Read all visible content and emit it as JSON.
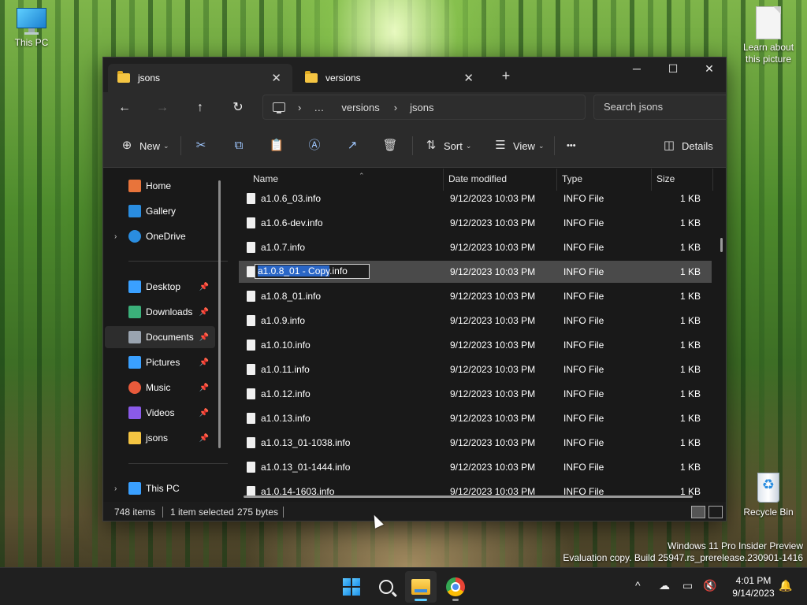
{
  "desktop": {
    "icons": [
      {
        "label": "This PC"
      },
      {
        "label": "Learn about this picture"
      },
      {
        "label": "Recycle Bin"
      }
    ],
    "watermark_line1": "Windows 11 Pro Insider Preview",
    "watermark_line2": "Evaluation copy. Build 25947.rs_prerelease.230901-1416"
  },
  "window": {
    "tabs": [
      {
        "label": "jsons",
        "active": true
      },
      {
        "label": "versions",
        "active": false
      }
    ],
    "new_tab": "+",
    "caption": {
      "minimize": "─",
      "maximize": "☐",
      "close": "✕"
    },
    "nav": {
      "back": "←",
      "forward": "→",
      "up": "↑",
      "refresh": "↻"
    },
    "breadcrumb": [
      "…",
      "versions",
      "jsons"
    ],
    "search_placeholder": "Search jsons",
    "toolbar": {
      "new_label": "New",
      "sort_label": "Sort",
      "view_label": "View",
      "more_label": "•••",
      "details_label": "Details"
    },
    "sidebar": {
      "items": [
        {
          "label": "Home",
          "color": "#e8743b",
          "expand": false,
          "pin": false
        },
        {
          "label": "Gallery",
          "color": "#2a8de0",
          "expand": false,
          "pin": false
        },
        {
          "label": "OneDrive",
          "color": "#2a8de0",
          "expand": true,
          "pin": false
        },
        {
          "label": "Desktop",
          "color": "#3aa0ff",
          "expand": false,
          "pin": true
        },
        {
          "label": "Downloads",
          "color": "#3bb07a",
          "expand": false,
          "pin": true
        },
        {
          "label": "Documents",
          "color": "#9aa4b0",
          "expand": false,
          "pin": true,
          "selected": true
        },
        {
          "label": "Pictures",
          "color": "#3aa0ff",
          "expand": false,
          "pin": true
        },
        {
          "label": "Music",
          "color": "#e85a3b",
          "expand": false,
          "pin": true
        },
        {
          "label": "Videos",
          "color": "#8a5ae8",
          "expand": false,
          "pin": true
        },
        {
          "label": "jsons",
          "color": "#f5c542",
          "expand": false,
          "pin": true
        },
        {
          "label": "This PC",
          "color": "#3aa0ff",
          "expand": true,
          "pin": false
        }
      ]
    },
    "columns": [
      "Name",
      "Date modified",
      "Type",
      "Size"
    ],
    "rename": {
      "selected_part": "a1.0.8_01 - Copy",
      "extension": ".info"
    },
    "files": [
      {
        "name": "a1.0.6_03.info",
        "date": "9/12/2023 10:03 PM",
        "type": "INFO File",
        "size": "1 KB"
      },
      {
        "name": "a1.0.6-dev.info",
        "date": "9/12/2023 10:03 PM",
        "type": "INFO File",
        "size": "1 KB"
      },
      {
        "name": "a1.0.7.info",
        "date": "9/12/2023 10:03 PM",
        "type": "INFO File",
        "size": "1 KB"
      },
      {
        "name": "a1.0.8_01 - Copy.info",
        "date": "9/12/2023 10:03 PM",
        "type": "INFO File",
        "size": "1 KB",
        "selected": true
      },
      {
        "name": "a1.0.8_01.info",
        "date": "9/12/2023 10:03 PM",
        "type": "INFO File",
        "size": "1 KB"
      },
      {
        "name": "a1.0.9.info",
        "date": "9/12/2023 10:03 PM",
        "type": "INFO File",
        "size": "1 KB"
      },
      {
        "name": "a1.0.10.info",
        "date": "9/12/2023 10:03 PM",
        "type": "INFO File",
        "size": "1 KB"
      },
      {
        "name": "a1.0.11.info",
        "date": "9/12/2023 10:03 PM",
        "type": "INFO File",
        "size": "1 KB"
      },
      {
        "name": "a1.0.12.info",
        "date": "9/12/2023 10:03 PM",
        "type": "INFO File",
        "size": "1 KB"
      },
      {
        "name": "a1.0.13.info",
        "date": "9/12/2023 10:03 PM",
        "type": "INFO File",
        "size": "1 KB"
      },
      {
        "name": "a1.0.13_01-1038.info",
        "date": "9/12/2023 10:03 PM",
        "type": "INFO File",
        "size": "1 KB"
      },
      {
        "name": "a1.0.13_01-1444.info",
        "date": "9/12/2023 10:03 PM",
        "type": "INFO File",
        "size": "1 KB"
      },
      {
        "name": "a1.0.14-1603.info",
        "date": "9/12/2023 10:03 PM",
        "type": "INFO File",
        "size": "1 KB"
      }
    ],
    "status": {
      "items_count": "748 items",
      "selection": "1 item selected",
      "size": "275 bytes"
    }
  },
  "taskbar": {
    "time": "4:01 PM",
    "date": "9/14/2023",
    "tray": {
      "chevron": "^"
    }
  }
}
